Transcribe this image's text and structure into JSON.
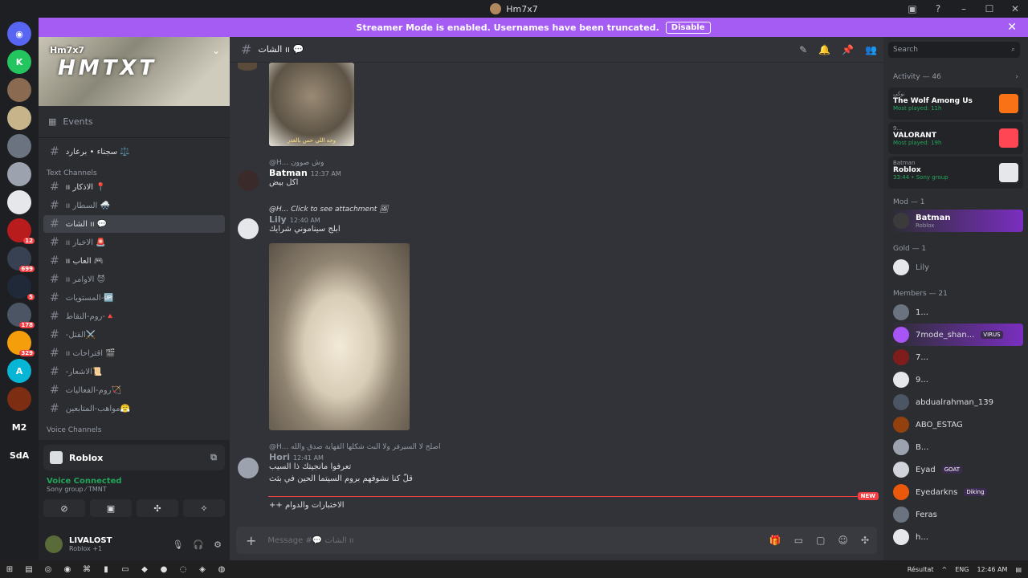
{
  "window": {
    "title": "Hm7x7",
    "controls": [
      "▣",
      "?",
      "–",
      "☐",
      "✕"
    ]
  },
  "streamer": {
    "text": "Streamer Mode is enabled. Usernames have been truncated.",
    "button": "Disable",
    "close": "✕"
  },
  "servers": [
    {
      "label": "◉",
      "color": "#5865f2"
    },
    {
      "label": "K",
      "color": "#22c55e"
    },
    {
      "label": "",
      "color": "#8a6a50",
      "badge": ""
    },
    {
      "label": "",
      "color": "#c8b48a"
    },
    {
      "label": "",
      "color": "#6b7280"
    },
    {
      "label": "",
      "color": "#9ca3af"
    },
    {
      "label": "",
      "color": "#e5e7eb"
    },
    {
      "label": "",
      "color": "#b91c1c",
      "badge": "12"
    },
    {
      "label": "",
      "color": "#374151",
      "badge": "699"
    },
    {
      "label": "",
      "color": "#1f2937",
      "badge": "5"
    },
    {
      "label": "",
      "color": "#4b5563",
      "badge": "178"
    },
    {
      "label": "",
      "color": "#f59e0b",
      "badge": "329"
    },
    {
      "label": "A",
      "color": "#06b6d4"
    },
    {
      "label": "",
      "color": "#7c2d12"
    },
    {
      "label": "M2",
      "color": "#1e1f22"
    },
    {
      "label": "SdA",
      "color": "#1e1f22"
    }
  ],
  "server": {
    "name": "Hm7x7",
    "banner_text": "HMTXT"
  },
  "sidebar": {
    "events": "Events",
    "top_channel": "سجناء • برعارد ⚖️",
    "text_category": "Text Channels",
    "channels": [
      {
        "name": "ıı الاذكار 📍",
        "active": false,
        "bright": true
      },
      {
        "name": "ıı السطار 🌨️",
        "active": false,
        "bright": false
      },
      {
        "name": "الشات ıı 💬",
        "active": true,
        "bright": true
      },
      {
        "name": "ıı الاخبار 🚨",
        "active": false,
        "bright": false
      },
      {
        "name": "ıı العاب 🎮",
        "active": false,
        "bright": true
      },
      {
        "name": "ıı الاوامر 😈",
        "active": false,
        "bright": false
      },
      {
        "name": "المستويات-🆙",
        "active": false,
        "bright": false
      },
      {
        "name": "روم-النقاط-🔺",
        "active": false,
        "bright": false
      },
      {
        "name": "-القتل⚔️",
        "active": false,
        "bright": false
      },
      {
        "name": "ıı اقتراحات 🎬",
        "active": false,
        "bright": false
      },
      {
        "name": "-الاشعار📜",
        "active": false,
        "bright": false
      },
      {
        "name": "روم-الفعاليات🏹",
        "active": false,
        "bright": false
      },
      {
        "name": "مواهب-المتابعين😤",
        "active": false,
        "bright": false
      }
    ],
    "voice_category": "Voice Channels"
  },
  "voice": {
    "activity": "Roblox",
    "status": "Voice Connected",
    "detail": "Sony group ⁄ TMNT"
  },
  "user": {
    "name": "LIVALOST",
    "status": "Roblox +1"
  },
  "chat": {
    "channel": "الشات ıı 💬",
    "messages": [
      {
        "reply": "@H... وش صوون",
        "author": "Batman",
        "time": "12:37 AM",
        "text": "اكل بيض"
      },
      {
        "reply": "@H... Click to see attachment 🖼",
        "author": "Lily",
        "time": "12:40 AM",
        "text": "ابلج سيناموني شرايك"
      },
      {
        "reply": "@H... اصلح لا السيرفر ولا البث شكلها القهاية صدق والله",
        "author": "Hori",
        "time": "12:41 AM",
        "text": "تعرفوا مانجيتك ذا السيب"
      },
      {
        "text": "قلّ كنا نشوفهم بروم السيتما الحين في بثث"
      },
      {
        "text": "++ الاختبارات والدوام"
      }
    ],
    "image1_caption": "وجه اللي حس بالغدر",
    "new_label": "NEW",
    "input_placeholder": "Message #💬 الشات ıı"
  },
  "members": {
    "search_placeholder": "Search",
    "activity_header": "Activity — 46",
    "activities": [
      {
        "user": "نوكي",
        "game": "The Wolf Among Us",
        "meta": "Most played: 11h",
        "color": "#f97316"
      },
      {
        "user": "9...",
        "game": "VALORANT",
        "meta": "Most played: 19h",
        "color": "#ff4655"
      },
      {
        "user": "Batman",
        "game": "Roblox",
        "meta": "33:44 • Sony group",
        "color": "#e5e7eb"
      }
    ],
    "mod_header": "Mod — 1",
    "mods": [
      {
        "name": "Batman",
        "sub": "Roblox",
        "color": "#3b3b3b"
      }
    ],
    "gold_header": "Gold — 1",
    "gold": [
      {
        "name": "Lily",
        "color": "#e5e7eb"
      }
    ],
    "members_header": "Members — 21",
    "list": [
      {
        "name": "1...",
        "tag": "",
        "color": "#6b7280"
      },
      {
        "name": "7mode_shan...",
        "tag": "VIRUS",
        "color": "#a855f7"
      },
      {
        "name": "7...",
        "tag": "",
        "color": "#7f1d1d"
      },
      {
        "name": "9...",
        "tag": "",
        "color": "#e5e7eb"
      },
      {
        "name": "abdualrahman_139",
        "tag": "",
        "color": "#4b5563"
      },
      {
        "name": "ABO_ESTAG",
        "tag": "",
        "color": "#92400e"
      },
      {
        "name": "B...",
        "tag": "",
        "color": "#9ca3af"
      },
      {
        "name": "Eyad",
        "tag": "GOAT",
        "color": "#d1d5db"
      },
      {
        "name": "Eyedarkns",
        "tag": "Diking",
        "color": "#ea580c"
      },
      {
        "name": "Feras",
        "tag": "",
        "color": "#6b7280"
      },
      {
        "name": "h...",
        "tag": "",
        "color": "#e5e7eb"
      }
    ]
  },
  "taskbar": {
    "tray": [
      "Résultat",
      "ENG",
      "12:46 AM"
    ]
  }
}
